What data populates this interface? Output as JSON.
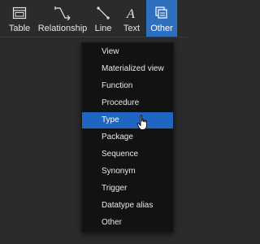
{
  "toolbar": {
    "items": [
      {
        "label": "Table",
        "icon": "table-icon"
      },
      {
        "label": "Relationship",
        "icon": "relationship-icon"
      },
      {
        "label": "Line",
        "icon": "line-icon"
      },
      {
        "label": "Text",
        "icon": "text-icon"
      },
      {
        "label": "Other",
        "icon": "other-icon",
        "active": true
      }
    ]
  },
  "menu": {
    "items": [
      {
        "label": "View"
      },
      {
        "label": "Materialized view"
      },
      {
        "label": "Function"
      },
      {
        "label": "Procedure"
      },
      {
        "label": "Type",
        "selected": true
      },
      {
        "label": "Package"
      },
      {
        "label": "Sequence"
      },
      {
        "label": "Synonym"
      },
      {
        "label": "Trigger"
      },
      {
        "label": "Datatype alias"
      },
      {
        "label": "Other"
      }
    ]
  },
  "colors": {
    "background": "#2a2b2d",
    "accent": "#2f6fbf",
    "menu_bg": "#121212",
    "menu_selected": "#1e66c2"
  }
}
